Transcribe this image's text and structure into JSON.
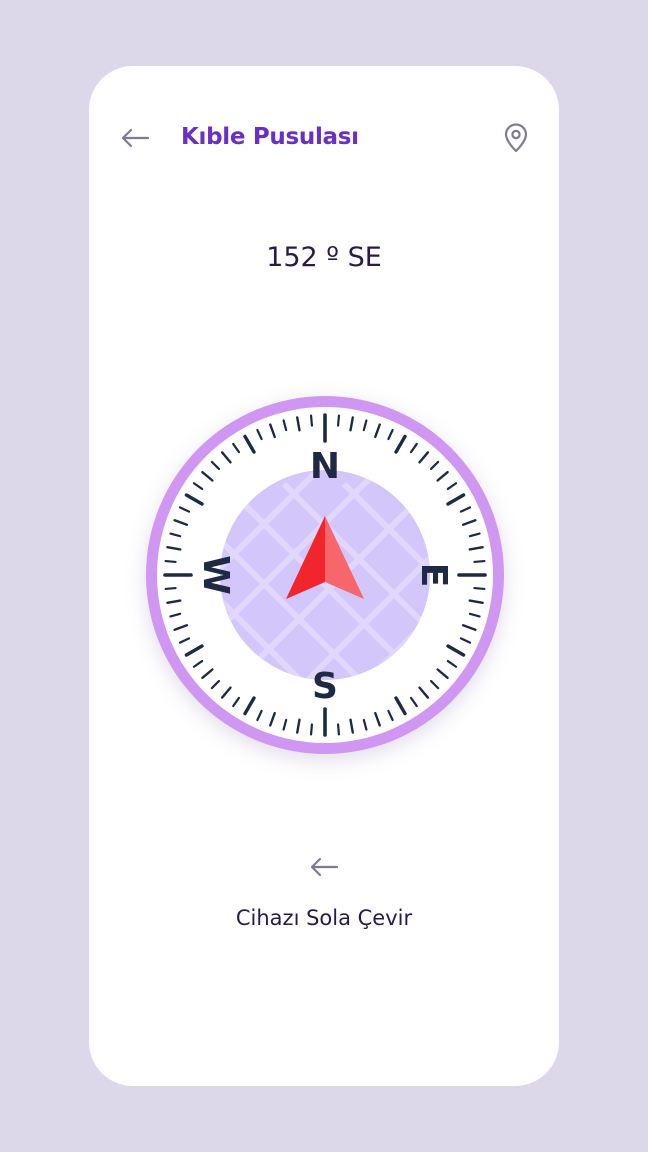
{
  "header": {
    "title": "Kıble Pusulası",
    "back_icon": "arrow-left-icon",
    "location_icon": "location-pin-icon"
  },
  "compass": {
    "heading_text": "152 º SE",
    "heading_degrees": 152,
    "cardinals": {
      "north": "N",
      "east": "E",
      "south": "S",
      "west": "W"
    },
    "needle_icon": "compass-needle-icon"
  },
  "instruction": {
    "icon": "arrow-left-icon",
    "text": "Cihazı Sola Çevir"
  },
  "colors": {
    "background": "#dcd8ea",
    "card": "#ffffff",
    "title": "#6a2fc4",
    "ring": "#cf97f2",
    "inner_disc": "#d3c6fa",
    "needle": "#f2242c",
    "needle_light": "#f7666b",
    "text_dark": "#2a1a4a",
    "tick": "#1e2a44"
  }
}
